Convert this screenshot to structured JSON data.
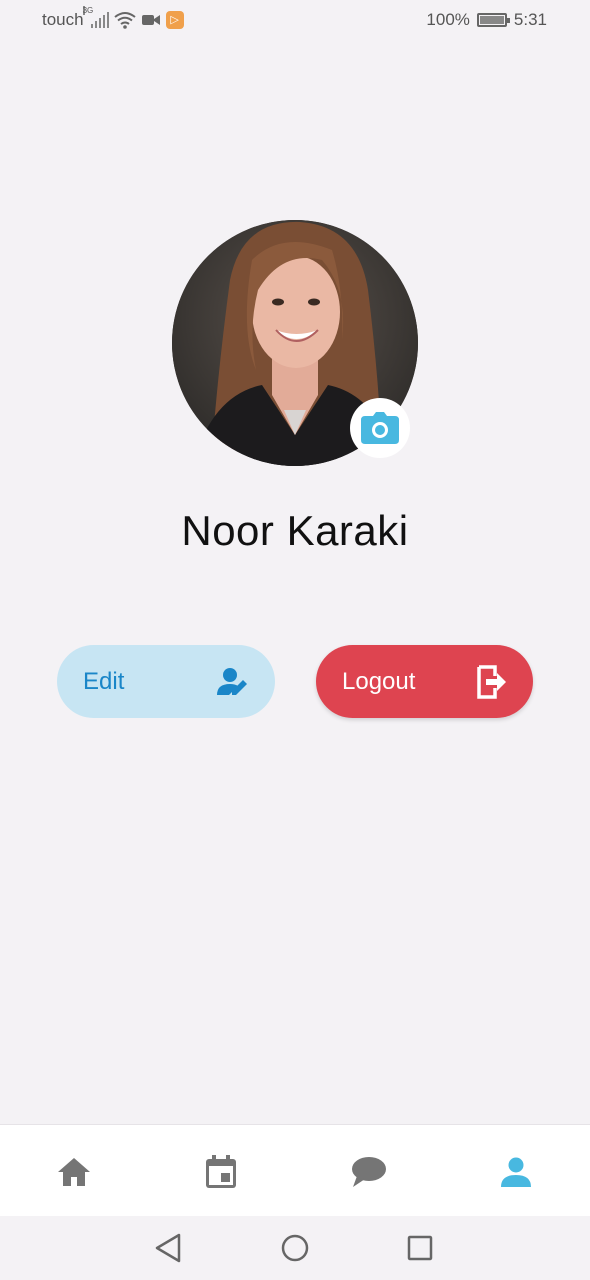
{
  "status_bar": {
    "carrier": "touch",
    "network": "3G",
    "battery": "100%",
    "time": "5:31"
  },
  "profile": {
    "name": "Noor Karaki",
    "photo_icon": "profile-photo",
    "camera_icon": "camera-icon"
  },
  "actions": {
    "edit_label": "Edit",
    "edit_icon": "edit-user-icon",
    "logout_label": "Logout",
    "logout_icon": "logout-icon"
  },
  "nav": {
    "items": [
      {
        "icon": "home-icon",
        "active": false
      },
      {
        "icon": "calendar-icon",
        "active": false
      },
      {
        "icon": "chat-icon",
        "active": false
      },
      {
        "icon": "person-icon",
        "active": true
      }
    ]
  },
  "colors": {
    "accent": "#48b8e0",
    "edit_bg": "#c7e5f3",
    "edit_text": "#1a86c8",
    "logout_bg": "#de4450",
    "inactive_icon": "#757575"
  }
}
